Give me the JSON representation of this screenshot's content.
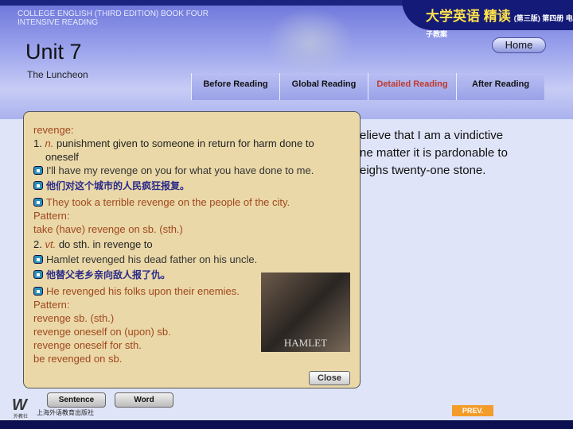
{
  "header": {
    "book_line1": "COLLEGE ENGLISH (THIRD EDITION) BOOK FOUR",
    "book_line2": "INTENSIVE READING",
    "brand": "大学英语 精读",
    "brand_small": "(第三版) 第四册 电子教案",
    "unit": "Unit 7",
    "subtitle": "The Luncheon",
    "home": "Home"
  },
  "tabs": [
    {
      "label": "Before Reading"
    },
    {
      "label": "Global Reading"
    },
    {
      "label": "Detailed Reading",
      "active": true
    },
    {
      "label": "After Reading"
    }
  ],
  "background_text": [
    "elieve that I am a vindictive",
    "ne matter it is pardonable to",
    "eighs twenty-one stone."
  ],
  "popup": {
    "word": "revenge:",
    "def1_num": "1.",
    "def1_pos": "n.",
    "def1_text": "punishment given to someone in return for harm done to",
    "def1_text2": "oneself",
    "ex1": "I'll have my revenge on you for what you have done to me.",
    "ex2_cn": "他们对这个城市的人民疯狂报复。",
    "ex2_en": "They took a terrible revenge on the people of the city.",
    "pattern1_label": "Pattern:",
    "pattern1": [
      "take (have) revenge on sb. (sth.)"
    ],
    "def2_num": "2.",
    "def2_pos": "vt.",
    "def2_text": "do sth. in revenge to",
    "ex3": "Hamlet revenged his dead father on his uncle.",
    "ex4_cn": "他替父老乡亲向敌人报了仇。",
    "ex4_en": "He revenged his folks upon their enemies.",
    "pattern2_label": "Pattern:",
    "pattern2": [
      "revenge sb. (sth.)",
      "revenge oneself on (upon) sb.",
      "revenge oneself for sth.",
      "be revenged on sb."
    ],
    "image_caption": "HAMLET",
    "close": "Close"
  },
  "footer": {
    "sentence": "Sentence",
    "word": "Word",
    "publisher": "上海外语教育出版社",
    "logo": "W",
    "logo_sub": "外教社",
    "prev": "PREV."
  },
  "colors": {
    "active_tab": "#c0392b",
    "popup_bg": "#ead8a8",
    "header": "#9aa2ec"
  }
}
